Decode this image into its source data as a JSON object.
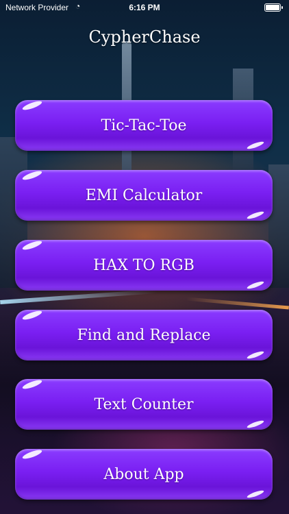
{
  "status_bar": {
    "carrier": "Network Provider",
    "time": "6:16 PM"
  },
  "app": {
    "title": "CypherChase"
  },
  "menu": {
    "items": [
      {
        "label": "Tic-Tac-Toe"
      },
      {
        "label": "EMI Calculator"
      },
      {
        "label": "HAX TO RGB"
      },
      {
        "label": "Find and Replace"
      },
      {
        "label": "Text Counter"
      },
      {
        "label": "About App"
      }
    ]
  }
}
